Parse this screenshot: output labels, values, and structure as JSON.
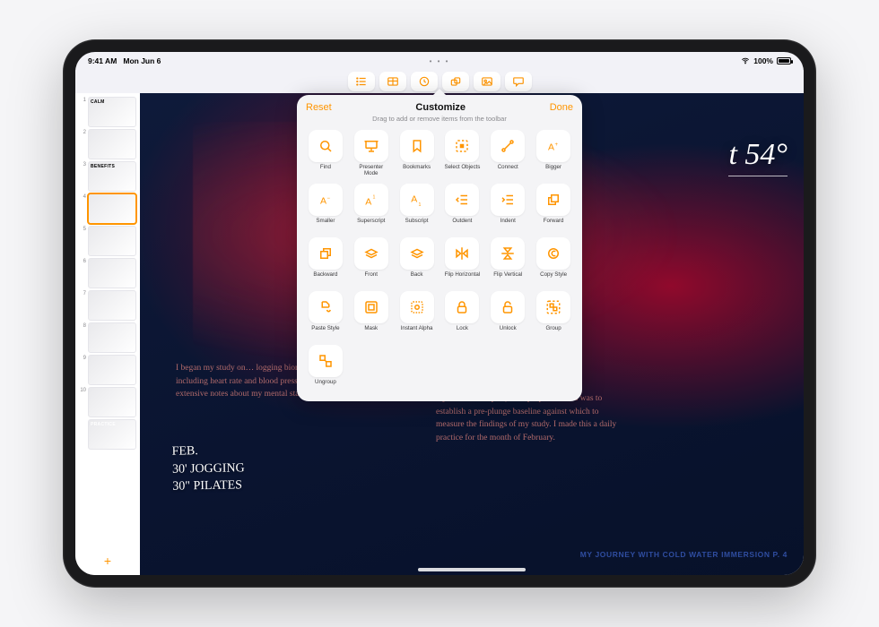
{
  "status": {
    "time": "9:41 AM",
    "date": "Mon Jun 6",
    "battery": "100%"
  },
  "accent": "#ff9500",
  "toolbar_icons": [
    "list-icon",
    "table-icon",
    "clock-icon",
    "shapes-icon",
    "photo-icon",
    "comment-icon"
  ],
  "popover": {
    "reset": "Reset",
    "title": "Customize",
    "done": "Done",
    "subtitle": "Drag to add or remove items from the toolbar",
    "items": [
      {
        "icon": "search-icon",
        "label": "Find"
      },
      {
        "icon": "presenter-icon",
        "label": "Presenter Mode"
      },
      {
        "icon": "bookmark-icon",
        "label": "Bookmarks"
      },
      {
        "icon": "select-objects-icon",
        "label": "Select Objects"
      },
      {
        "icon": "connect-icon",
        "label": "Connect"
      },
      {
        "icon": "bigger-text-icon",
        "label": "Bigger"
      },
      {
        "icon": "smaller-text-icon",
        "label": "Smaller"
      },
      {
        "icon": "superscript-icon",
        "label": "Superscript"
      },
      {
        "icon": "subscript-icon",
        "label": "Subscript"
      },
      {
        "icon": "outdent-icon",
        "label": "Outdent"
      },
      {
        "icon": "indent-icon",
        "label": "Indent"
      },
      {
        "icon": "forward-icon",
        "label": "Forward"
      },
      {
        "icon": "backward-icon",
        "label": "Backward"
      },
      {
        "icon": "front-icon",
        "label": "Front"
      },
      {
        "icon": "back-icon",
        "label": "Back"
      },
      {
        "icon": "flip-horizontal-icon",
        "label": "Flip Horizontal"
      },
      {
        "icon": "flip-vertical-icon",
        "label": "Flip Vertical"
      },
      {
        "icon": "copy-style-icon",
        "label": "Copy Style"
      },
      {
        "icon": "paste-style-icon",
        "label": "Paste Style"
      },
      {
        "icon": "mask-icon",
        "label": "Mask"
      },
      {
        "icon": "instant-alpha-icon",
        "label": "Instant Alpha"
      },
      {
        "icon": "lock-icon",
        "label": "Lock"
      },
      {
        "icon": "unlock-icon",
        "label": "Unlock"
      },
      {
        "icon": "group-icon",
        "label": "Group"
      },
      {
        "icon": "ungroup-icon",
        "label": "Ungroup"
      }
    ]
  },
  "slides": [
    {
      "n": "1",
      "label": "CALM"
    },
    {
      "n": "2",
      "label": ""
    },
    {
      "n": "3",
      "label": "BENEFITS"
    },
    {
      "n": "4",
      "label": ""
    },
    {
      "n": "5",
      "label": ""
    },
    {
      "n": "6",
      "label": ""
    },
    {
      "n": "7",
      "label": ""
    },
    {
      "n": "8",
      "label": ""
    },
    {
      "n": "9",
      "label": ""
    },
    {
      "n": "10",
      "label": "PRACTICE"
    }
  ],
  "stage": {
    "headline": "t 54°",
    "col_left": "I began my study on… logging biometric data including heart rate and blood pressure, and taking extensive notes about my mental state (Appendix A in",
    "col_right": "my submitted report). The purpose of this was to establish a pre-plunge baseline against which to measure the findings of my study. I made this a daily practice for the month of February.",
    "handwritten": "FEB.\n30' JOGGING\n30\" PILATES",
    "footer": "MY JOURNEY WITH COLD WATER IMMERSION    P. 4"
  }
}
